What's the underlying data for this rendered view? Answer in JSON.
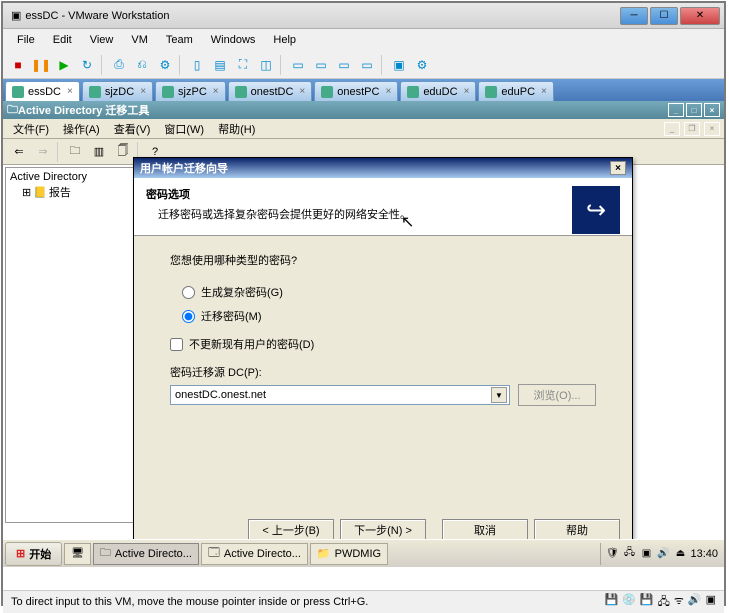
{
  "window": {
    "title": "essDC - VMware Workstation"
  },
  "menu": {
    "file": "File",
    "edit": "Edit",
    "view": "View",
    "vm": "VM",
    "team": "Team",
    "windows": "Windows",
    "help": "Help"
  },
  "tabs": [
    {
      "label": "essDC",
      "active": true
    },
    {
      "label": "sjzDC",
      "active": false
    },
    {
      "label": "sjzPC",
      "active": false
    },
    {
      "label": "onestDC",
      "active": false
    },
    {
      "label": "onestPC",
      "active": false
    },
    {
      "label": "eduDC",
      "active": false
    },
    {
      "label": "eduPC",
      "active": false
    }
  ],
  "ad": {
    "title": "Active Directory 迁移工具",
    "menu": {
      "file": "文件(F)",
      "action": "操作(A)",
      "view": "查看(V)",
      "window": "窗口(W)",
      "help": "帮助(H)"
    },
    "tree": {
      "root": "Active Directory",
      "child": "报告"
    }
  },
  "wizard": {
    "title": "用户帐户迁移向导",
    "header_title": "密码选项",
    "header_sub": "迁移密码或选择复杂密码会提供更好的网络安全性。",
    "question": "您想使用哪种类型的密码?",
    "opt_generate": "生成复杂密码(G)",
    "opt_migrate": "迁移密码(M)",
    "chk_noupdate": "不更新现有用户的密码(D)",
    "src_label": "密码迁移源 DC(P):",
    "src_value": "onestDC.onest.net",
    "browse": "浏览(O)...",
    "back": "< 上一步(B)",
    "next": "下一步(N) >",
    "cancel": "取消",
    "help": "帮助"
  },
  "taskbar": {
    "start": "开始",
    "tasks": [
      {
        "label": "Active Directo...",
        "active": true
      },
      {
        "label": "Active Directo...",
        "active": false
      },
      {
        "label": "PWDMIG",
        "active": false
      }
    ],
    "time": "13:40"
  },
  "status": {
    "text": "To direct input to this VM, move the mouse pointer inside or press Ctrl+G."
  }
}
